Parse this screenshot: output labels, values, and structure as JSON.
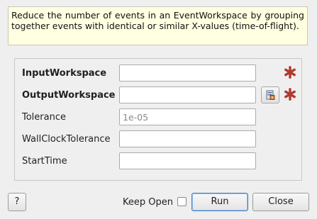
{
  "description": "Reduce the number of events in an EventWorkspace by grouping together events with identical or similar X-values (time-of-flight).",
  "properties": [
    {
      "label": "InputWorkspace",
      "value": "",
      "placeholder": "",
      "required": true
    },
    {
      "label": "OutputWorkspace",
      "value": "",
      "placeholder": "",
      "required": true
    },
    {
      "label": "Tolerance",
      "value": "",
      "placeholder": "1e-05",
      "required": false
    },
    {
      "label": "WallClockTolerance",
      "value": "",
      "placeholder": "",
      "required": false
    },
    {
      "label": "StartTime",
      "value": "",
      "placeholder": "",
      "required": false
    }
  ],
  "footer": {
    "help_label": "?",
    "keep_open_label": "Keep Open",
    "keep_open_checked": false,
    "run_label": "Run",
    "close_label": "Close"
  },
  "colors": {
    "required_star": "#b03a2e",
    "description_bg": "#ffffe1",
    "default_button_border": "#4a7fbf"
  },
  "icons": {
    "required": "asterisk-icon",
    "workspace_browse": "workspace-browse-icon"
  }
}
